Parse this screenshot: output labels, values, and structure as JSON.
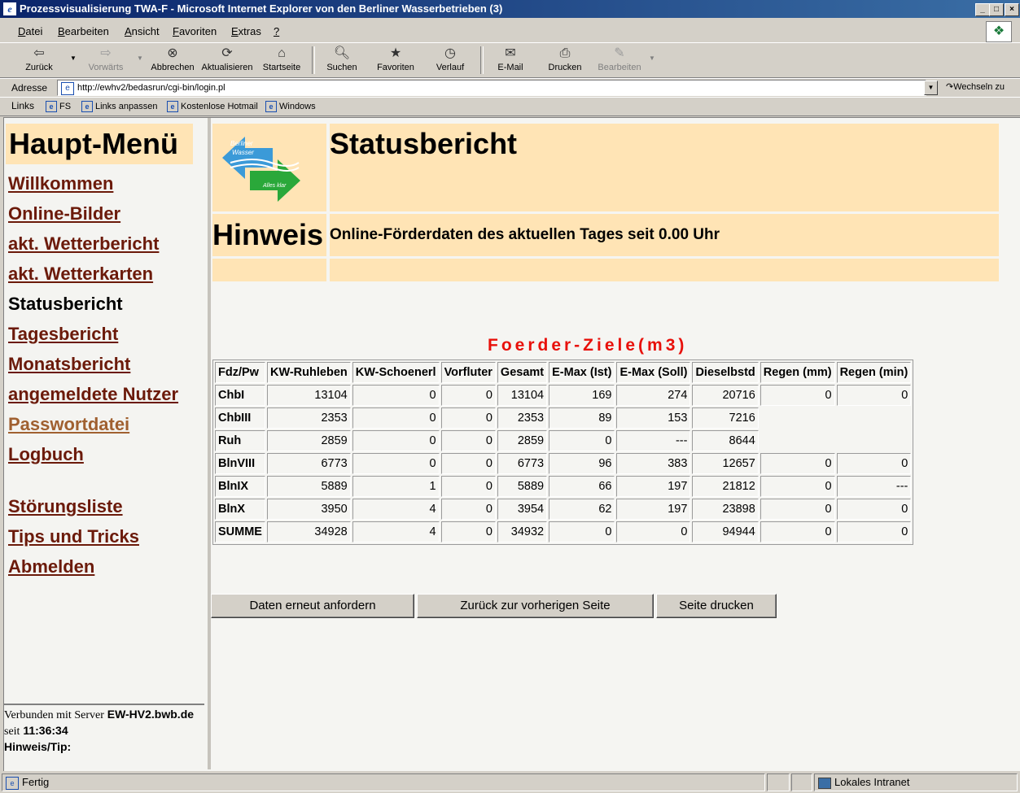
{
  "window": {
    "title": "Prozessvisualisierung TWA-F - Microsoft Internet Explorer von den Berliner Wasserbetrieben (3)",
    "minimize": "_",
    "maximize": "□",
    "close": "×"
  },
  "menubar": {
    "items": [
      {
        "key": "D",
        "rest": "atei"
      },
      {
        "key": "B",
        "rest": "earbeiten"
      },
      {
        "key": "A",
        "rest": "nsicht"
      },
      {
        "key": "F",
        "rest": "avoriten"
      },
      {
        "key": "E",
        "rest": "xtras"
      },
      {
        "key": "?",
        "rest": ""
      }
    ]
  },
  "toolbar": {
    "back": "Zurück",
    "forward": "Vorwärts",
    "stop": "Abbrechen",
    "refresh": "Aktualisieren",
    "home": "Startseite",
    "search": "Suchen",
    "favorites": "Favoriten",
    "history": "Verlauf",
    "mail": "E-Mail",
    "print": "Drucken",
    "edit": "Bearbeiten"
  },
  "address": {
    "label": "Adresse",
    "url": "http://ewhv2/bedasrun/cgi-bin/login.pl",
    "go": "Wechseln zu"
  },
  "links": {
    "label": "Links",
    "items": [
      "FS",
      "Links anpassen",
      "Kostenlose Hotmail",
      "Windows"
    ]
  },
  "sidebar": {
    "heading": "Haupt-Menü",
    "items": [
      "Willkommen",
      "Online-Bilder",
      "akt. Wetterbericht",
      "akt. Wetterkarten",
      "Statusbericht",
      "Tagesbericht",
      "Monatsbericht",
      "angemeldete Nutzer",
      "Passwortdatei",
      "Logbuch",
      "Störungsliste",
      "Tips und Tricks",
      "Abmelden"
    ],
    "status": {
      "connected": "Verbunden mit Server",
      "server": "EW-HV2.bwb.de",
      "since": "seit",
      "time": "11:36:34",
      "hint": "Hinweis/Tip:"
    }
  },
  "main": {
    "logo": {
      "line1": "Berliner",
      "line2": "Wasser",
      "tagline": "Alles klar"
    },
    "title": "Statusbericht",
    "hint_label": "Hinweis",
    "hint_text": "Online-Förderdaten des aktuellen Tages seit 0.00 Uhr",
    "table_title": "Foerder-Ziele(m3)",
    "columns": [
      "Fdz/Pw",
      "KW-Ruhleben",
      "KW-Schoenerl",
      "Vorfluter",
      "Gesamt",
      "E-Max (Ist)",
      "E-Max (Soll)",
      "Dieselbstd",
      "Regen (mm)",
      "Regen (min)"
    ],
    "rows": [
      [
        "ChbI",
        "13104",
        "0",
        "0",
        "13104",
        "169",
        "274",
        "20716",
        "0",
        "0"
      ],
      [
        "ChbIII",
        "2353",
        "0",
        "0",
        "2353",
        "89",
        "153",
        "7216",
        "",
        ""
      ],
      [
        "Ruh",
        "2859",
        "0",
        "0",
        "2859",
        "0",
        "---",
        "8644",
        "",
        ""
      ],
      [
        "BlnVIII",
        "6773",
        "0",
        "0",
        "6773",
        "96",
        "383",
        "12657",
        "0",
        "0"
      ],
      [
        "BlnIX",
        "5889",
        "1",
        "0",
        "5889",
        "66",
        "197",
        "21812",
        "0",
        "---"
      ],
      [
        "BlnX",
        "3950",
        "4",
        "0",
        "3954",
        "62",
        "197",
        "23898",
        "0",
        "0"
      ],
      [
        "SUMME",
        "34928",
        "4",
        "0",
        "34932",
        "0",
        "0",
        "94944",
        "0",
        "0"
      ]
    ],
    "buttons": {
      "reload": "Daten erneut anfordern",
      "back": "Zurück zur vorherigen Seite",
      "print": "Seite drucken"
    }
  },
  "statusbar": {
    "text": "Fertig",
    "zone": "Lokales Intranet"
  }
}
